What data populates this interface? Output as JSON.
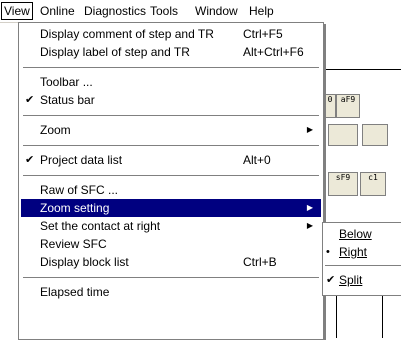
{
  "menubar": {
    "items": [
      {
        "label": "View"
      },
      {
        "label": "Online"
      },
      {
        "label": "Diagnostics"
      },
      {
        "label": "Tools"
      },
      {
        "label": "Window"
      },
      {
        "label": "Help"
      }
    ]
  },
  "view_menu": {
    "items": [
      {
        "label": "Display comment of step and TR",
        "shortcut": "Ctrl+F5"
      },
      {
        "label": "Display label of step and TR",
        "shortcut": "Alt+Ctrl+F6"
      },
      {
        "label": "Toolbar ..."
      },
      {
        "label": "Status bar",
        "checked": "✔"
      },
      {
        "label": "Zoom"
      },
      {
        "label": "Project data list",
        "shortcut": "Alt+0",
        "checked": "✔"
      },
      {
        "label": "Raw of SFC ..."
      },
      {
        "label": "Zoom setting"
      },
      {
        "label": "Set the contact at right"
      },
      {
        "label": "Review SFC"
      },
      {
        "label": "Display block list",
        "shortcut": "Ctrl+B"
      },
      {
        "label": "Elapsed time"
      }
    ]
  },
  "zoom_setting_submenu": {
    "items": [
      {
        "label": "Below"
      },
      {
        "label": "Right",
        "bullet": "•"
      },
      {
        "label": "Split",
        "checked": "✔"
      }
    ]
  },
  "toolbar_fragments": {
    "btn1": "0",
    "btn2": "aF9",
    "btn3": "sF9",
    "btn4": "c1"
  },
  "colors": {
    "highlight": "#000080",
    "menu_bg": "#ffffff",
    "border": "#808080"
  }
}
